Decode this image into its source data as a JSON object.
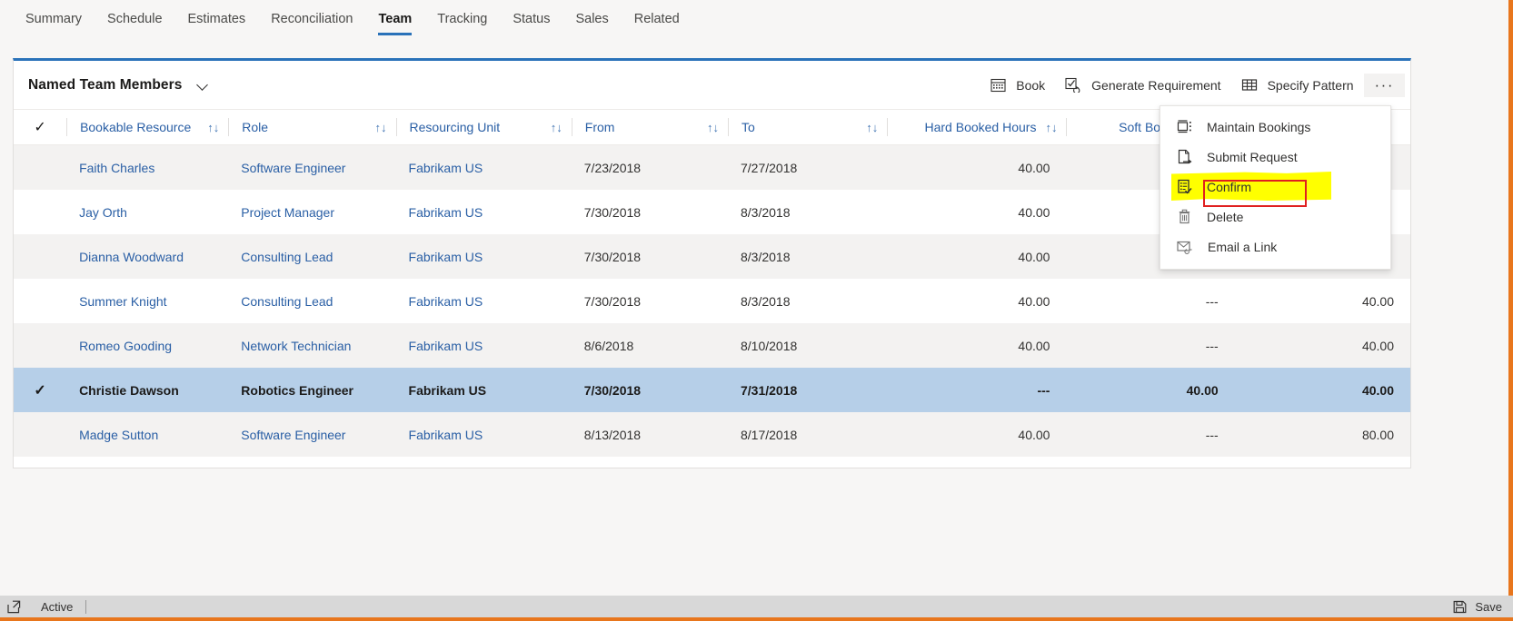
{
  "nav": {
    "tabs": [
      {
        "label": "Summary",
        "active": false
      },
      {
        "label": "Schedule",
        "active": false
      },
      {
        "label": "Estimates",
        "active": false
      },
      {
        "label": "Reconciliation",
        "active": false
      },
      {
        "label": "Team",
        "active": true
      },
      {
        "label": "Tracking",
        "active": false
      },
      {
        "label": "Status",
        "active": false
      },
      {
        "label": "Sales",
        "active": false
      },
      {
        "label": "Related",
        "active": false
      }
    ]
  },
  "panel": {
    "view_name": "Named Team Members",
    "commands": [
      {
        "label": "Book",
        "icon": "calendar-icon"
      },
      {
        "label": "Generate Requirement",
        "icon": "checkbox-refresh-icon"
      },
      {
        "label": "Specify Pattern",
        "icon": "table-grid-icon"
      }
    ],
    "more_label": "···"
  },
  "table": {
    "columns": [
      {
        "label": "Bookable Resource",
        "sortable": true,
        "numeric": false
      },
      {
        "label": "Role",
        "sortable": true,
        "numeric": false
      },
      {
        "label": "Resourcing Unit",
        "sortable": true,
        "numeric": false
      },
      {
        "label": "From",
        "sortable": true,
        "numeric": false
      },
      {
        "label": "To",
        "sortable": true,
        "numeric": false
      },
      {
        "label": "Hard Booked Hours",
        "sortable": true,
        "numeric": true
      },
      {
        "label": "Soft Booked Hours",
        "sortable": false,
        "numeric": true
      },
      {
        "label": "",
        "sortable": false,
        "numeric": true
      }
    ],
    "sort_glyph": "↑↓",
    "check_glyph": "✓",
    "rows": [
      {
        "selected": false,
        "resource": "Faith Charles",
        "role": "Software Engineer",
        "unit": "Fabrikam US",
        "from": "7/23/2018",
        "to": "7/27/2018",
        "hard": "40.00",
        "soft": "",
        "total": ""
      },
      {
        "selected": false,
        "resource": "Jay Orth",
        "role": "Project Manager",
        "unit": "Fabrikam US",
        "from": "7/30/2018",
        "to": "8/3/2018",
        "hard": "40.00",
        "soft": "",
        "total": ""
      },
      {
        "selected": false,
        "resource": "Dianna Woodward",
        "role": "Consulting Lead",
        "unit": "Fabrikam US",
        "from": "7/30/2018",
        "to": "8/3/2018",
        "hard": "40.00",
        "soft": "",
        "total": ""
      },
      {
        "selected": false,
        "resource": "Summer Knight",
        "role": "Consulting Lead",
        "unit": "Fabrikam US",
        "from": "7/30/2018",
        "to": "8/3/2018",
        "hard": "40.00",
        "soft": "---",
        "total": "40.00"
      },
      {
        "selected": false,
        "resource": "Romeo Gooding",
        "role": "Network Technician",
        "unit": "Fabrikam US",
        "from": "8/6/2018",
        "to": "8/10/2018",
        "hard": "40.00",
        "soft": "---",
        "total": "40.00"
      },
      {
        "selected": true,
        "resource": "Christie Dawson",
        "role": "Robotics Engineer",
        "unit": "Fabrikam US",
        "from": "7/30/2018",
        "to": "7/31/2018",
        "hard": "---",
        "soft": "40.00",
        "total": "40.00"
      },
      {
        "selected": false,
        "resource": "Madge Sutton",
        "role": "Software Engineer",
        "unit": "Fabrikam US",
        "from": "8/13/2018",
        "to": "8/17/2018",
        "hard": "40.00",
        "soft": "---",
        "total": "80.00"
      }
    ]
  },
  "context_menu": {
    "items": [
      {
        "label": "Maintain Bookings",
        "icon": "maintain-bookings-icon",
        "highlighted": false
      },
      {
        "label": "Submit Request",
        "icon": "submit-request-icon",
        "highlighted": false
      },
      {
        "label": "Confirm",
        "icon": "confirm-checklist-icon",
        "highlighted": true
      },
      {
        "label": "Delete",
        "icon": "trash-icon",
        "highlighted": false
      },
      {
        "label": "Email a Link",
        "icon": "email-link-icon",
        "highlighted": false
      }
    ],
    "highlight_color": "#ffff00",
    "annotation_color": "#e02020"
  },
  "footer": {
    "status": "Active",
    "save_label": "Save"
  },
  "theme": {
    "accent": "#2a72b9",
    "link": "#2a5fa5",
    "selected_row": "#b6cfe8",
    "alt_row": "#f3f2f1",
    "orange_rail": "#e8761d"
  }
}
